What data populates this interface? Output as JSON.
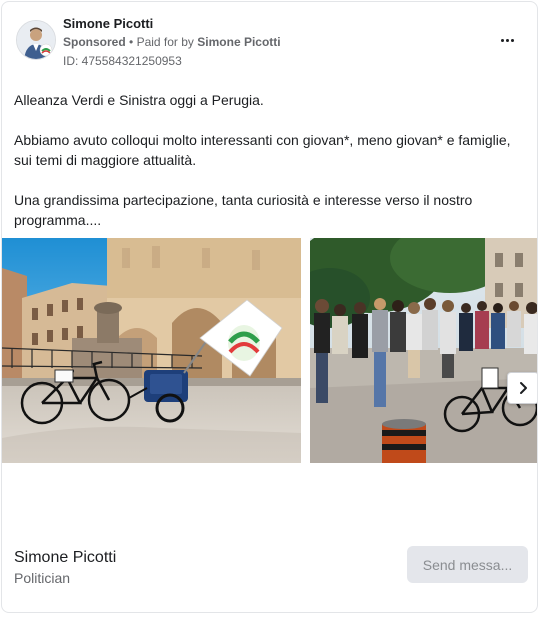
{
  "advertiser": {
    "name": "Simone Picotti",
    "sponsored_label": "Sponsored",
    "separator": "•",
    "paid_for_prefix": "Paid for by",
    "paid_for_name": "Simone Picotti",
    "ad_id": "ID: 475584321250953"
  },
  "post": {
    "paragraph_1": "Alleanza Verdi e Sinistra oggi a Perugia.",
    "paragraph_2": "Abbiamo avuto colloqui molto interessanti con giovan*, meno giovan* e famiglie, sui temi di maggiore attualità.",
    "paragraph_3": "Una grandissima partecipazione, tanta curiosità e interesse verso il nostro programma...."
  },
  "footer": {
    "page_name": "Simone Picotti",
    "page_category": "Politician",
    "cta_label": "Send messa..."
  },
  "icons": {
    "more": "more-options-icon",
    "next": "chevron-right-icon"
  },
  "colors": {
    "secondary_text": "#65676b",
    "cta_disabled_bg": "#e4e6eb",
    "cta_disabled_text": "#8a8d91",
    "card_border": "#e3e5e8"
  }
}
